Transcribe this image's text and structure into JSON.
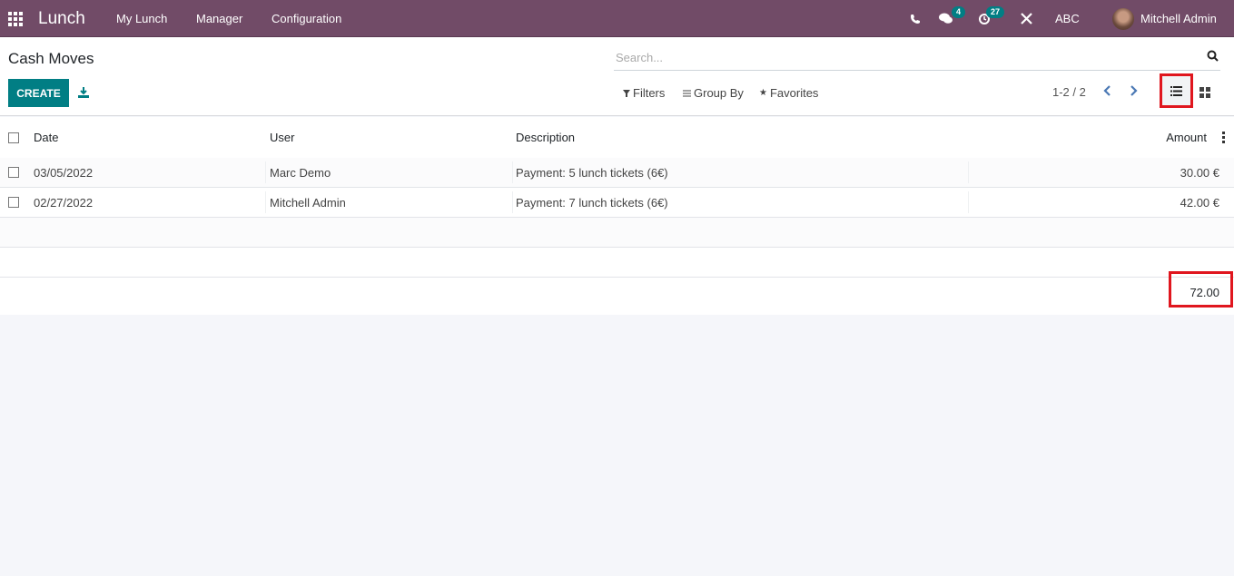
{
  "navbar": {
    "app_name": "Lunch",
    "menu": [
      "My Lunch",
      "Manager",
      "Configuration"
    ],
    "messages_count": "4",
    "activities_count": "27",
    "company": "ABC",
    "user_name": "Mitchell Admin",
    "colors": {
      "brand": "#714b67",
      "badge": "#017e84"
    }
  },
  "control_panel": {
    "title": "Cash Moves",
    "create_label": "CREATE",
    "search_placeholder": "Search...",
    "filters_label": "Filters",
    "group_by_label": "Group By",
    "favorites_label": "Favorites",
    "pager": "1-2 / 2",
    "active_view": "list"
  },
  "table": {
    "columns": [
      "Date",
      "User",
      "Description",
      "Amount"
    ],
    "rows": [
      {
        "date": "03/05/2022",
        "user": "Marc Demo",
        "description": "Payment: 5 lunch tickets (6€)",
        "amount": "30.00 €"
      },
      {
        "date": "02/27/2022",
        "user": "Mitchell Admin",
        "description": "Payment: 7 lunch tickets (6€)",
        "amount": "42.00 €"
      }
    ],
    "total": "72.00"
  }
}
